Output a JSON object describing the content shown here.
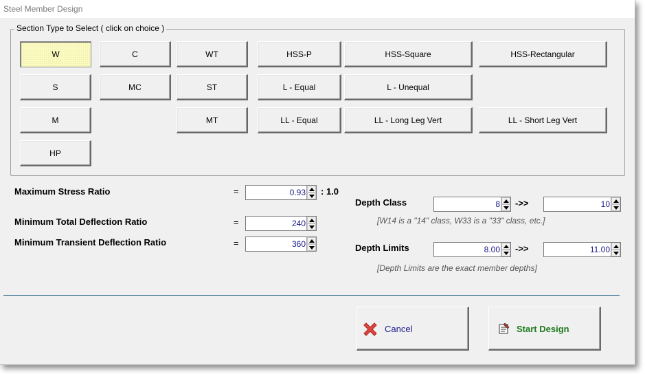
{
  "window": {
    "title": "Steel Member Design"
  },
  "section_group": {
    "legend": "Section Type to Select  ( click on choice )",
    "buttons": {
      "w": "W",
      "c": "C",
      "wt": "WT",
      "hss_p": "HSS-P",
      "hss_square": "HSS-Square",
      "hss_rect": "HSS-Rectangular",
      "s": "S",
      "mc": "MC",
      "st": "ST",
      "l_equal": "L - Equal",
      "l_unequal": "L - Unequal",
      "m": "M",
      "mt": "MT",
      "ll_equal": "LL - Equal",
      "ll_long": "LL - Long Leg Vert",
      "ll_short": "LL - Short Leg Vert",
      "hp": "HP"
    },
    "selected": "W"
  },
  "params": {
    "max_stress": {
      "label": "Maximum Stress Ratio",
      "eq": "=",
      "value": "0.93",
      "suffix": ": 1.0"
    },
    "min_total_defl": {
      "label": "Minimum Total Deflection Ratio",
      "eq": "=",
      "value": "240"
    },
    "min_trans_defl": {
      "label": "Minimum Transient Deflection Ratio",
      "eq": "=",
      "value": "360"
    }
  },
  "depth_class": {
    "label": "Depth Class",
    "from": "8",
    "arrow": "->>",
    "to": "10",
    "note": "[W14 is a \"14\" class, W33 is a \"33\" class, etc.]"
  },
  "depth_limits": {
    "label": "Depth Limits",
    "from": "8.00",
    "arrow": "->>",
    "to": "11.00",
    "note": "[Depth Limits are the exact member depths]"
  },
  "actions": {
    "cancel": "Cancel",
    "start": "Start Design"
  },
  "colors": {
    "selected_button": "#ffffc6",
    "value_text": "#1a1a8c",
    "start_text": "#1e7a1e",
    "cancel_text": "#1a1a8c",
    "separator": "#2e6b8c"
  },
  "icons": {
    "cancel": "red-x-icon",
    "start": "design-sheet-icon"
  }
}
